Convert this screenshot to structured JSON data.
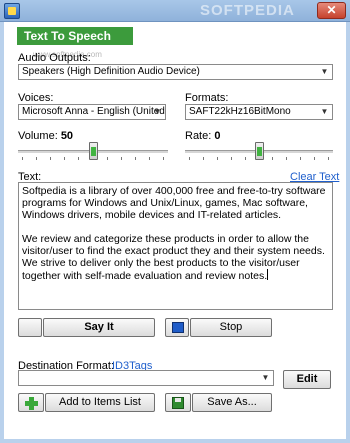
{
  "watermark": "SOFTPEDIA",
  "window": {
    "close": "✕"
  },
  "header": {
    "title": "Text To Speech",
    "sub_watermark": "www.softpedia.com"
  },
  "audio_outputs": {
    "label": "Audio Outputs:",
    "value": "Speakers (High Definition Audio Device)"
  },
  "voices": {
    "label": "Voices:",
    "value": "Microsoft Anna - English (United States"
  },
  "formats": {
    "label": "Formats:",
    "value": "SAFT22kHz16BitMono"
  },
  "volume": {
    "label": "Volume:",
    "value": "50",
    "level": 0.5
  },
  "rate": {
    "label": "Rate:",
    "value": "0",
    "level": 0.5
  },
  "text": {
    "label": "Text:",
    "clear_label": "Clear Text",
    "p1": "Softpedia is a library of over 400,000 free and free-to-try software programs for Windows and Unix/Linux, games, Mac software, Windows drivers, mobile devices and IT-related articles.",
    "p2": "We review and categorize these products in order to allow the visitor/user to find the exact product they and their system needs. We strive to deliver only the best products to the visitor/user together with self-made evaluation and review notes."
  },
  "actions": {
    "say_it": "Say It",
    "stop": "Stop"
  },
  "destination": {
    "label": "Destination Format:",
    "link": "ID3Tags",
    "value": "",
    "edit": "Edit"
  },
  "bottom": {
    "add": "Add to Items List",
    "save_as": "Save As..."
  },
  "colors": {
    "accent_green": "#3c9b3c",
    "link_blue": "#1f5fcc",
    "stop_blue": "#1f5cc8"
  }
}
